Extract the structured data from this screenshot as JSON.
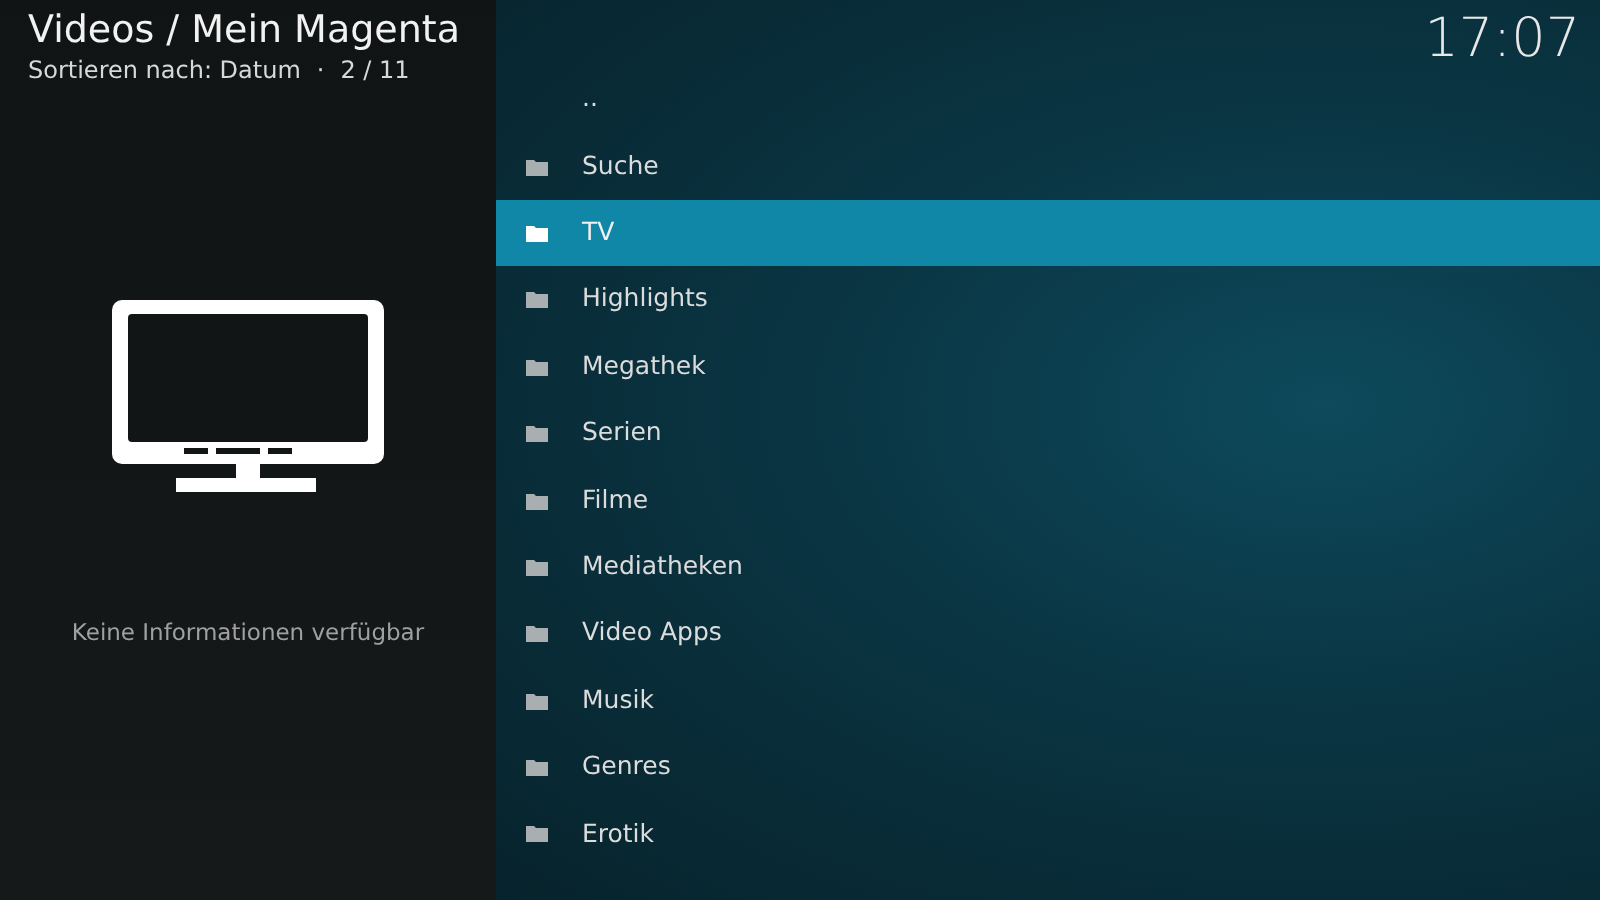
{
  "header": {
    "title": "Videos / Mein Magenta",
    "sort": "Sortieren nach: Datum",
    "separator": "·",
    "position": "2 / 11"
  },
  "clock": "17:07",
  "info": {
    "text": "Keine Informationen verfügbar"
  },
  "items": [
    {
      "kind": "parent",
      "label": "..",
      "selected": false
    },
    {
      "kind": "folder",
      "label": "Suche",
      "selected": false
    },
    {
      "kind": "folder",
      "label": "TV",
      "selected": true
    },
    {
      "kind": "folder",
      "label": "Highlights",
      "selected": false
    },
    {
      "kind": "folder",
      "label": "Megathek",
      "selected": false
    },
    {
      "kind": "folder",
      "label": "Serien",
      "selected": false
    },
    {
      "kind": "folder",
      "label": "Filme",
      "selected": false
    },
    {
      "kind": "folder",
      "label": "Mediatheken",
      "selected": false
    },
    {
      "kind": "folder",
      "label": "Video Apps",
      "selected": false
    },
    {
      "kind": "folder",
      "label": "Musik",
      "selected": false
    },
    {
      "kind": "folder",
      "label": "Genres",
      "selected": false
    },
    {
      "kind": "folder",
      "label": "Erotik",
      "selected": false
    }
  ]
}
